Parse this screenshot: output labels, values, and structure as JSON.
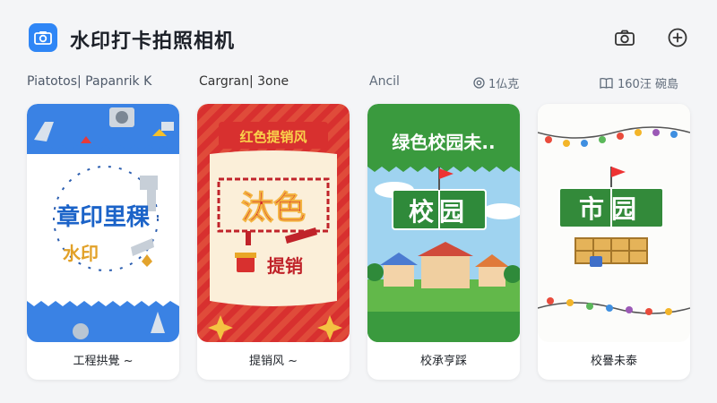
{
  "header": {
    "title": "水印打卡拍照相机",
    "app_icon": "camera-icon",
    "actions": [
      {
        "icon": "camera-icon"
      },
      {
        "icon": "plus-circle-icon"
      }
    ]
  },
  "tabs": [
    {
      "label": "Piatotos| Papanrik K"
    },
    {
      "label": "Cargran| 3one"
    },
    {
      "label": "Ancil"
    },
    {
      "label": "1仏克",
      "icon": "target-icon"
    },
    {
      "label": "160汪 碗島",
      "icon": "book-icon"
    }
  ],
  "cards": [
    {
      "label": "工程拱覺 ~",
      "poster_title": "章印里稞",
      "poster_sub": "水印",
      "accent": "#3a82e4"
    },
    {
      "label": "提销风 ~",
      "banner": "红色提销风",
      "poster_title": "汰色",
      "poster_sub": "提销",
      "accent": "#d8302f"
    },
    {
      "label": "校承亨踩",
      "banner": "绿色校园未..",
      "poster_title": "校园",
      "accent": "#3a9a3e"
    },
    {
      "label": "校謈未泰",
      "poster_title": "市园",
      "accent": "#3a8e3c"
    }
  ]
}
